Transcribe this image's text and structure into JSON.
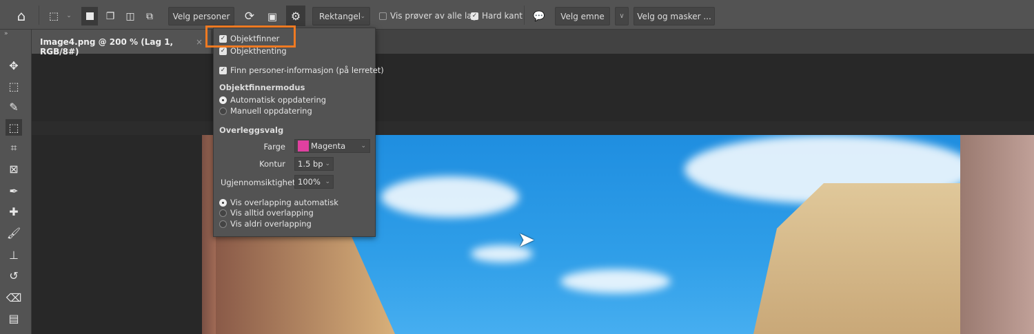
{
  "toolbar": {
    "velg_personer": "Velg personer",
    "mode_select": "Rektangel",
    "sample_all_layers": "Vis prøver av alle lag",
    "hard_edge": "Hard kant",
    "select_subject": "Velg emne",
    "select_and_mask": "Velg og masker ..."
  },
  "document_tab": {
    "title": "Image4.png @ 200 % (Lag 1, RGB/8#)",
    "close": "×"
  },
  "menu": {
    "objektfinner": "Objektfinner",
    "objekthenting": "Objekthenting",
    "finn_personer": "Finn personer-informasjon (på lerretet)",
    "mode_header": "Objektfinnermodus",
    "auto_update": "Automatisk oppdatering",
    "manual_update": "Manuell oppdatering",
    "overlay_header": "Overleggsvalg",
    "color_label": "Farge",
    "color_value": "Magenta",
    "color_hex": "#e040a0",
    "outline_label": "Kontur",
    "outline_value": "1.5 bp",
    "opacity_label": "Ugjennomsiktighet",
    "opacity_value": "100%",
    "overlap_auto": "Vis overlapping automatisk",
    "overlap_always": "Vis alltid overlapping",
    "overlap_never": "Vis aldri overlapping"
  },
  "highlight_color": "#f07a21"
}
